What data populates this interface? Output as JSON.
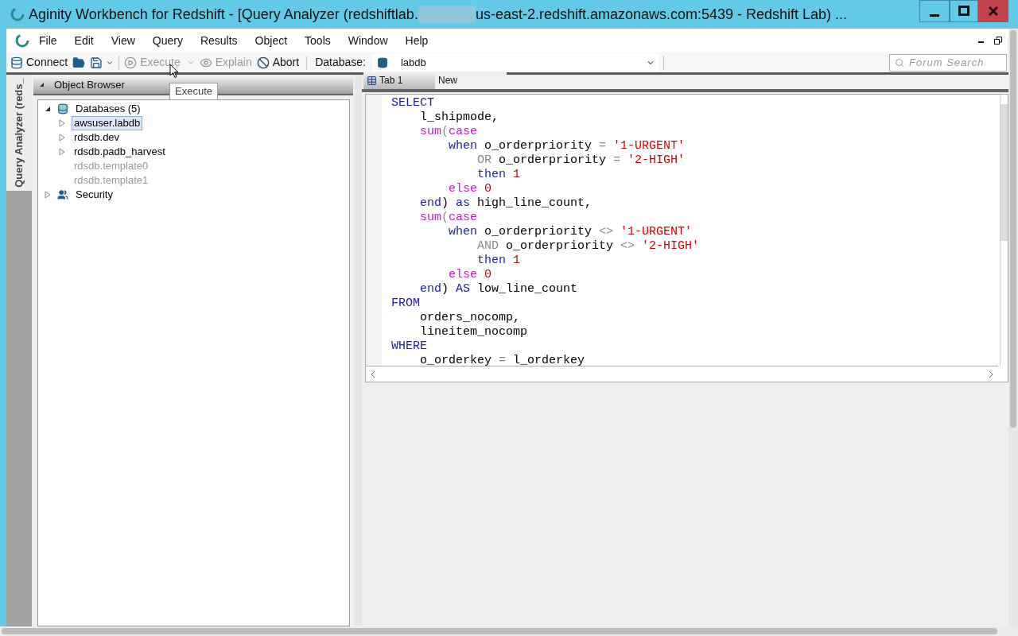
{
  "window": {
    "title_start": "Aginity Workbench for Redshift - [Query Analyzer (redshiftlab.",
    "title_end": "us-east-2.redshift.amazonaws.com:5439 - Redshift Lab) ..."
  },
  "menu": [
    "File",
    "Edit",
    "View",
    "Query",
    "Results",
    "Object",
    "Tools",
    "Window",
    "Help"
  ],
  "toolbar": {
    "items": [
      {
        "kind": "connect",
        "label": "Connect",
        "disabled": false
      },
      {
        "kind": "open"
      },
      {
        "kind": "save"
      },
      {
        "kind": "execute",
        "label": "Execute",
        "disabled": true
      },
      {
        "kind": "explain",
        "label": "Explain",
        "disabled": true
      },
      {
        "kind": "abort",
        "label": "Abort",
        "disabled": false
      }
    ],
    "database_label": "Database:",
    "database_value": "labdb",
    "search_placeholder": "Forum Search"
  },
  "tooltip": "Execute",
  "side_tab": "Query Analyzer (reds_",
  "object_browser": {
    "title": "Object Browser",
    "tree": [
      {
        "label": "Databases (5)",
        "kind": "databases",
        "expandable": true,
        "expanded": true,
        "selected": false,
        "disabled": false,
        "children": [
          {
            "label": "awsuser.labdb",
            "expandable": true,
            "expanded": false,
            "selected": true,
            "disabled": false
          },
          {
            "label": "rdsdb.dev",
            "expandable": true,
            "expanded": false,
            "selected": false,
            "disabled": false
          },
          {
            "label": "rdsdb.padb_harvest",
            "expandable": true,
            "expanded": false,
            "selected": false,
            "disabled": false
          },
          {
            "label": "rdsdb.template0",
            "expandable": false,
            "selected": false,
            "disabled": true
          },
          {
            "label": "rdsdb.template1",
            "expandable": false,
            "selected": false,
            "disabled": true
          }
        ]
      },
      {
        "label": "Security",
        "kind": "security",
        "expandable": true,
        "expanded": false,
        "selected": false,
        "disabled": false
      }
    ]
  },
  "tabs": [
    {
      "label": "Tab 1",
      "selected": true
    },
    {
      "label": "New",
      "selected": false
    }
  ],
  "editor": {
    "lines": [
      [
        {
          "kind": "keyword",
          "text": "SELECT"
        }
      ],
      [
        {
          "kind": "plain",
          "text": "    l_shipmode,"
        }
      ],
      [
        {
          "kind": "function",
          "text": "    sum"
        },
        {
          "kind": "operator",
          "text": "("
        },
        {
          "kind": "function",
          "text": "case"
        }
      ],
      [
        {
          "kind": "keyword",
          "text": "        when"
        },
        {
          "kind": "plain",
          "text": " o_orderpriority "
        },
        {
          "kind": "operator",
          "text": "="
        },
        {
          "kind": "string",
          "text": " '1-URGENT'"
        }
      ],
      [
        {
          "kind": "operator",
          "text": "            OR"
        },
        {
          "kind": "plain",
          "text": " o_orderpriority "
        },
        {
          "kind": "operator",
          "text": "="
        },
        {
          "kind": "string",
          "text": " '2-HIGH'"
        }
      ],
      [
        {
          "kind": "keyword",
          "text": "            then"
        },
        {
          "kind": "number",
          "text": " 1"
        }
      ],
      [
        {
          "kind": "function",
          "text": "        else"
        },
        {
          "kind": "number",
          "text": " 0"
        }
      ],
      [
        {
          "kind": "keyword",
          "text": "    end"
        },
        {
          "kind": "plain",
          "text": ") "
        },
        {
          "kind": "keyword",
          "text": "as"
        },
        {
          "kind": "plain",
          "text": " high_line_count,"
        }
      ],
      [
        {
          "kind": "function",
          "text": "    sum"
        },
        {
          "kind": "operator",
          "text": "("
        },
        {
          "kind": "function",
          "text": "case"
        }
      ],
      [
        {
          "kind": "keyword",
          "text": "        when"
        },
        {
          "kind": "plain",
          "text": " o_orderpriority "
        },
        {
          "kind": "operator",
          "text": "<>"
        },
        {
          "kind": "string",
          "text": " '1-URGENT'"
        }
      ],
      [
        {
          "kind": "operator",
          "text": "            AND"
        },
        {
          "kind": "plain",
          "text": " o_orderpriority "
        },
        {
          "kind": "operator",
          "text": "<>"
        },
        {
          "kind": "string",
          "text": " '2-HIGH'"
        }
      ],
      [
        {
          "kind": "keyword",
          "text": "            then"
        },
        {
          "kind": "number",
          "text": " 1"
        }
      ],
      [
        {
          "kind": "function",
          "text": "        else"
        },
        {
          "kind": "number",
          "text": " 0"
        }
      ],
      [
        {
          "kind": "keyword",
          "text": "    end"
        },
        {
          "kind": "plain",
          "text": ") "
        },
        {
          "kind": "keyword",
          "text": "AS"
        },
        {
          "kind": "plain",
          "text": " low_line_count"
        }
      ],
      [
        {
          "kind": "keyword",
          "text": "FROM"
        }
      ],
      [
        {
          "kind": "plain",
          "text": "    orders_nocomp,"
        }
      ],
      [
        {
          "kind": "plain",
          "text": "    lineitem_nocomp"
        }
      ],
      [
        {
          "kind": "keyword",
          "text": "WHERE"
        }
      ],
      [
        {
          "kind": "plain",
          "text": "    o_orderkey "
        },
        {
          "kind": "operator",
          "text": "="
        },
        {
          "kind": "plain",
          "text": " l_orderkey"
        }
      ]
    ]
  }
}
